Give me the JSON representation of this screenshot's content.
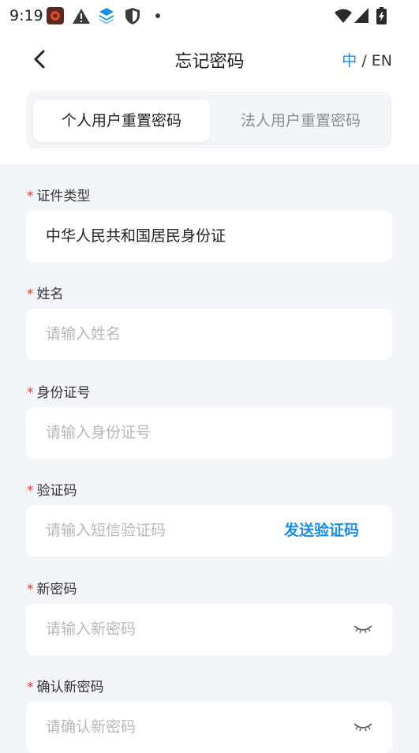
{
  "status": {
    "time": "9:19"
  },
  "nav": {
    "title": "忘记密码",
    "lang_zh": "中",
    "lang_sep": " / ",
    "lang_en": "EN"
  },
  "tabs": [
    {
      "label": "个人用户重置密码",
      "active": true
    },
    {
      "label": "法人用户重置密码",
      "active": false
    }
  ],
  "form": {
    "required_mark": "*",
    "id_type": {
      "label": "证件类型",
      "value": "中华人民共和国居民身份证"
    },
    "name": {
      "label": "姓名",
      "placeholder": "请输入姓名"
    },
    "id_number": {
      "label": "身份证号",
      "placeholder": "请输入身份证号"
    },
    "sms_code": {
      "label": "验证码",
      "placeholder": "请输入短信验证码",
      "action": "发送验证码"
    },
    "new_password": {
      "label": "新密码",
      "placeholder": "请输入新密码"
    },
    "confirm_password": {
      "label": "确认新密码",
      "placeholder": "请确认新密码"
    }
  },
  "colors": {
    "accent": "#1a8fe6",
    "required": "#e23a2e",
    "background": "#f4f5f8"
  }
}
